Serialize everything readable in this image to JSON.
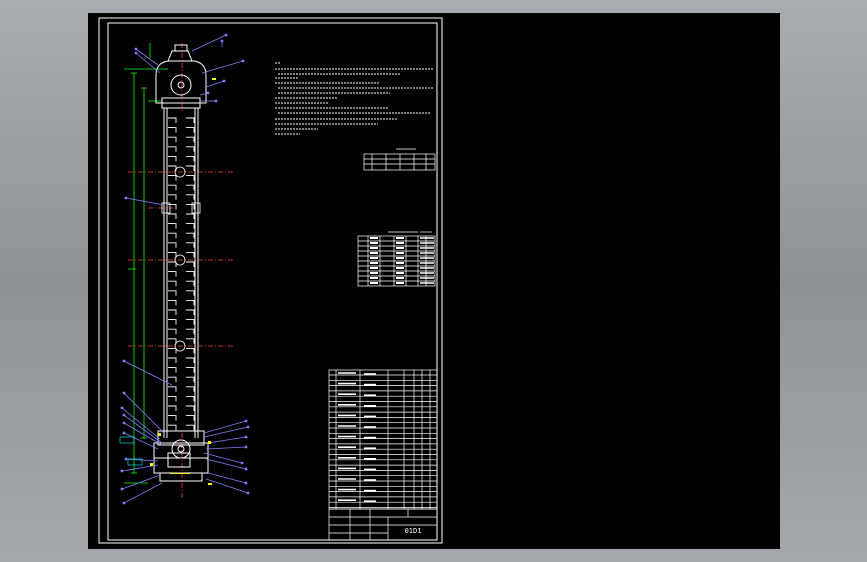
{
  "drawing": {
    "title_block": {
      "drawing_number": "01D1"
    }
  },
  "colors": {
    "viewport_background": "#000000",
    "frame_line": "#ffffff",
    "dimension_line": "#00ff00",
    "leader_line": "#8080ff",
    "center_line": "#ff4040",
    "annotation_marker": "#ffff00"
  }
}
